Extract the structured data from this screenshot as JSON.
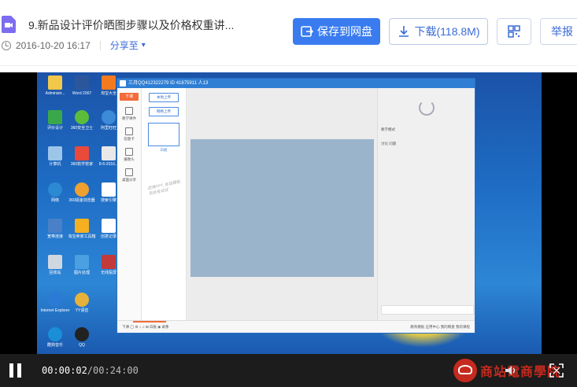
{
  "header": {
    "title": "9.新品设计评价晒图步骤以及价格权重讲...",
    "date": "2016-10-20 16:17",
    "share_label": "分享至",
    "save_label": "保存到网盘",
    "download_label": "下载(118.8M)",
    "report_label": "举报"
  },
  "player": {
    "current_time": "00:00:02",
    "total_time": "/00:24:00",
    "watermark": "商站電商學院",
    "desktop_icons": [
      "Administr...",
      "Word 2007",
      "淘宝大全",
      "评价设计",
      "360安全卫士",
      "阿里旺旺",
      "计算机",
      "360软件管家",
      "8-6-2016...",
      "网络",
      "360极速浏览器",
      "搜索引擎",
      "宽带连接",
      "淘宝卖家工具箱",
      "创意记录",
      "回收站",
      "图片处理",
      "无线投屏",
      "Internet Explorer",
      "YY语音",
      "酷狗音乐",
      "QQ"
    ],
    "app": {
      "title": "三月QQ412322279  ID 41875911  人13",
      "left_tab": "下课",
      "left_items": [
        "教学课件",
        "答题卡",
        "摄像头",
        "桌面分享"
      ],
      "upload_local": "本地上传",
      "upload_net": "网络上传",
      "thumb_label": "白板",
      "handwriting": "武将PPT, 会话模板, 到处有试试",
      "right_mode": "教学模式",
      "right_tabs": "讨论   问题",
      "bottom_left": "下课  ◯  ⚙  ♪  ♫  ⊞  白板  ◉ 录像",
      "bottom_right": "教育模板  应用中心  我的网盘  我的课程"
    }
  },
  "colors": {
    "accent": "#3a7cf0",
    "desktop_bg": "#1e6cc4",
    "watermark_red": "#c62a1e"
  }
}
